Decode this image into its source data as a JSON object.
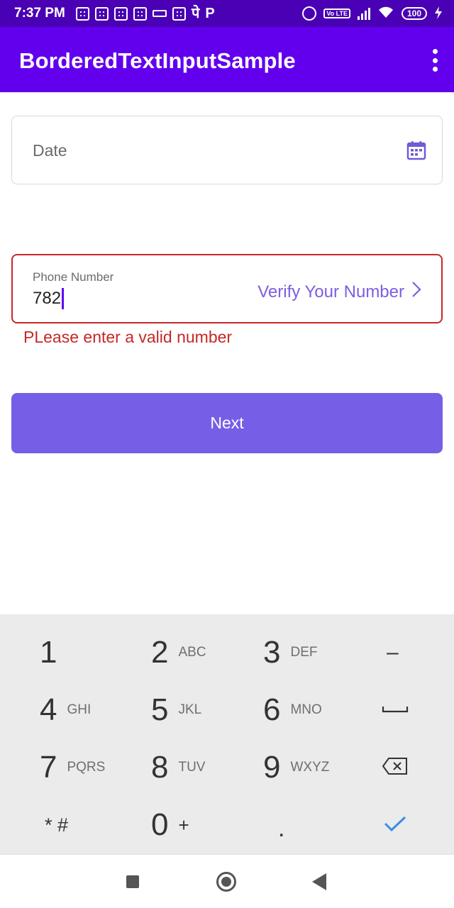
{
  "status_bar": {
    "time": "7:37 PM",
    "volte": "Vo LTE",
    "battery": "100"
  },
  "app_bar": {
    "title": "BorderedTextInputSample",
    "overflow_icon": "more-vert-icon"
  },
  "date_field": {
    "placeholder": "Date",
    "icon": "calendar-icon"
  },
  "phone_field": {
    "label": "Phone Number",
    "value": "782",
    "verify_label": "Verify Your Number",
    "error": "PLease enter a valid number",
    "error_color": "#c62828"
  },
  "next_button": {
    "label": "Next",
    "color": "#775ee6"
  },
  "keypad": {
    "keys": [
      {
        "digit": "1",
        "letters": ""
      },
      {
        "digit": "2",
        "letters": "ABC"
      },
      {
        "digit": "3",
        "letters": "DEF"
      },
      {
        "digit": "–",
        "letters": ""
      },
      {
        "digit": "4",
        "letters": "GHI"
      },
      {
        "digit": "5",
        "letters": "JKL"
      },
      {
        "digit": "6",
        "letters": "MNO"
      },
      {
        "digit": "␣",
        "letters": ""
      },
      {
        "digit": "7",
        "letters": "PQRS"
      },
      {
        "digit": "8",
        "letters": "TUV"
      },
      {
        "digit": "9",
        "letters": "WXYZ"
      },
      {
        "digit": "⌫",
        "letters": ""
      },
      {
        "digit": "* #",
        "letters": ""
      },
      {
        "digit": "0",
        "letters": "+"
      },
      {
        "digit": ".",
        "letters": ""
      },
      {
        "digit": "✓",
        "letters": ""
      }
    ]
  },
  "colors": {
    "status_bar": "#4a00b4",
    "app_bar": "#6200ee",
    "accent": "#7c5fe0"
  }
}
